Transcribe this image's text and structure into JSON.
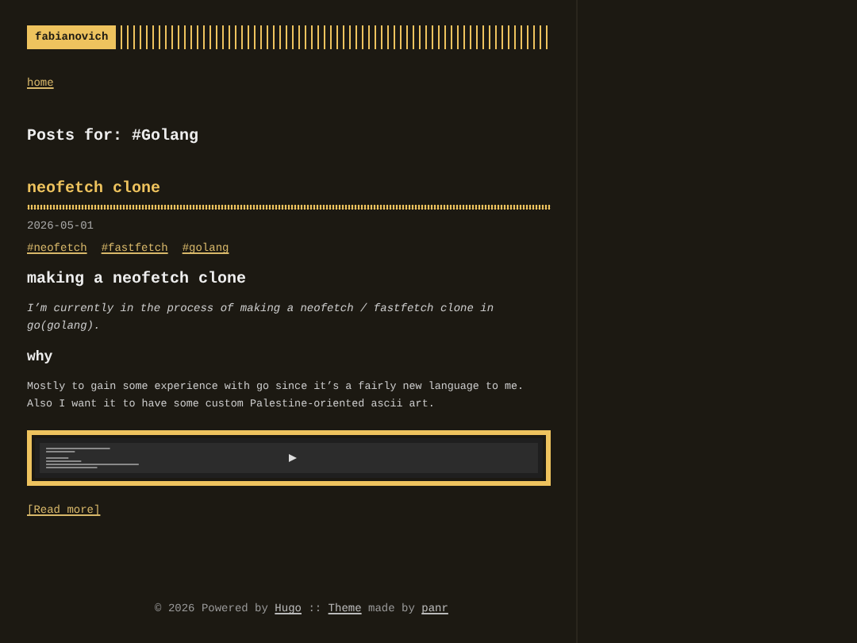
{
  "header": {
    "logo": "fabianovich",
    "menu": [
      {
        "label": "home"
      }
    ]
  },
  "page_title": "Posts for: #Golang",
  "post": {
    "title": "neofetch clone",
    "date": "2026-05-01",
    "tags": [
      {
        "label": "#neofetch"
      },
      {
        "label": "#fastfetch"
      },
      {
        "label": "#golang"
      }
    ],
    "heading": "making a neofetch clone",
    "intro": "I’m currently in the process of making a neofetch / fastfetch clone in go(golang).",
    "subheading": "why",
    "body": "Mostly to gain some experience with go since it’s a fairly new language to me. Also I want it to have some custom Palestine-oriented ascii art.",
    "read_more": "[Read more]"
  },
  "footer": [
    {
      "kind": "text",
      "text": "© 2026 Powered by"
    },
    {
      "kind": "link",
      "text": "Hugo"
    },
    {
      "kind": "text",
      "text": "::"
    },
    {
      "kind": "link",
      "text": "Theme"
    },
    {
      "kind": "text",
      "text": "made by"
    },
    {
      "kind": "link",
      "text": "panr"
    }
  ]
}
